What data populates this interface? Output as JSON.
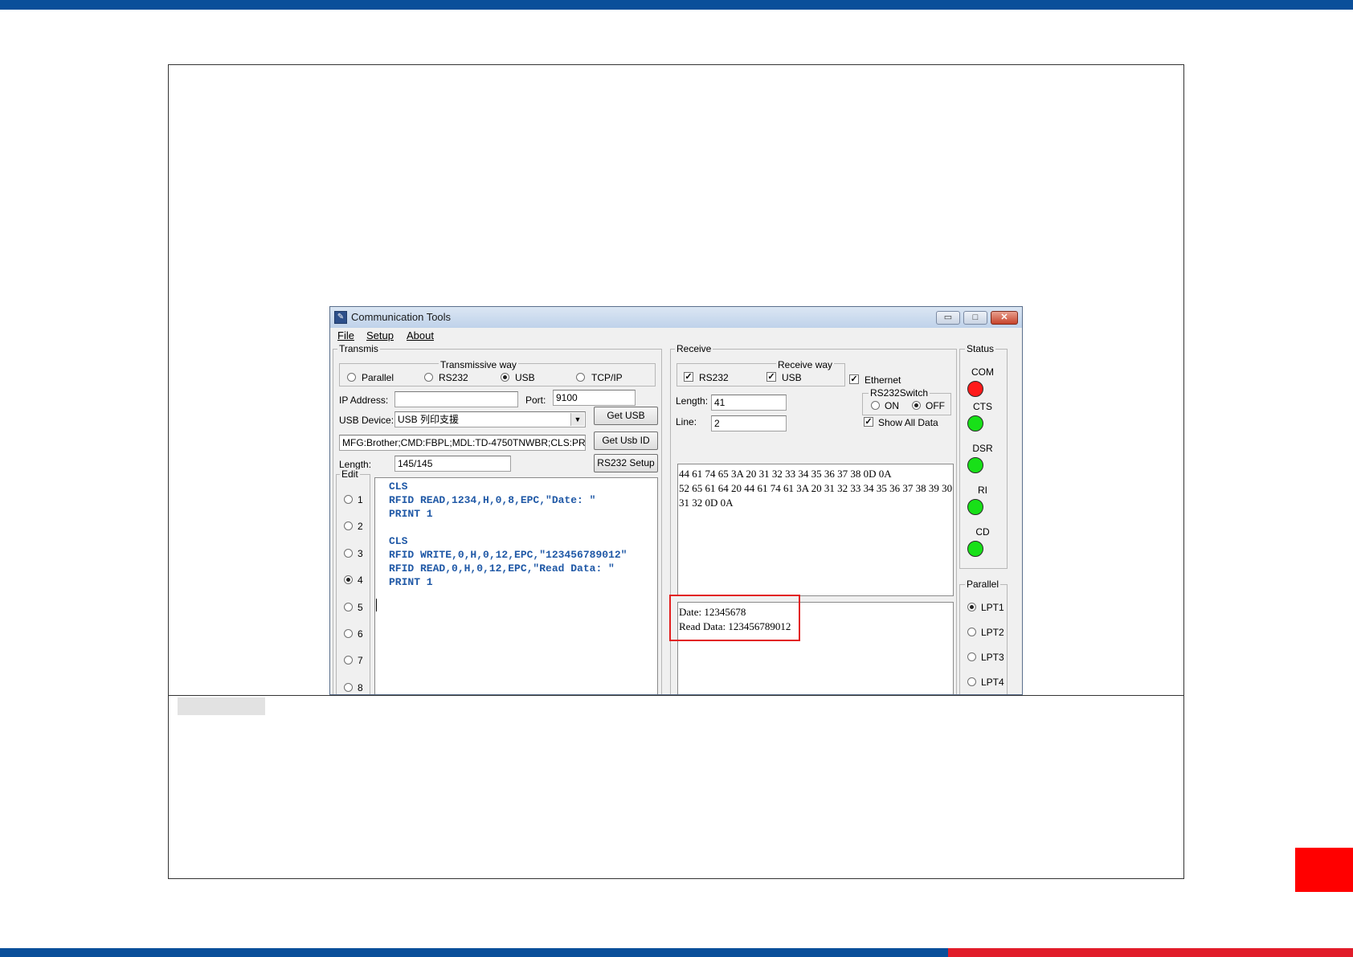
{
  "window": {
    "title": "Communication Tools",
    "icon": "app-icon",
    "controls": {
      "minimize": "▭",
      "maximize": "□",
      "close": "✕"
    }
  },
  "menu": [
    "File",
    "Setup",
    "About"
  ],
  "transmit": {
    "group_label": "Transmis",
    "way_label": "Transmissive way",
    "ways": [
      {
        "label": "Parallel",
        "selected": false
      },
      {
        "label": "RS232",
        "selected": false
      },
      {
        "label": "USB",
        "selected": true
      },
      {
        "label": "TCP/IP",
        "selected": false
      }
    ],
    "ip_label": "IP Address:",
    "ip_value": "",
    "port_label": "Port:",
    "port_value": "9100",
    "usb_device_label": "USB Device:",
    "usb_device_value": "USB 列印支援",
    "usb_id_value": "MFG:Brother;CMD:FBPL;MDL:TD-4750TNWBR;CLS:PRINTER",
    "length_label": "Length:",
    "length_value": "145/145",
    "get_usb_button": "Get USB",
    "get_usb_id_button": "Get Usb ID",
    "rs232_setup_button": "RS232 Setup"
  },
  "edit": {
    "group_label": "Edit",
    "slots": [
      {
        "label": "1",
        "selected": false
      },
      {
        "label": "2",
        "selected": false
      },
      {
        "label": "3",
        "selected": false
      },
      {
        "label": "4",
        "selected": true
      },
      {
        "label": "5",
        "selected": false
      },
      {
        "label": "6",
        "selected": false
      },
      {
        "label": "7",
        "selected": false
      },
      {
        "label": "8",
        "selected": false
      }
    ],
    "code": [
      "CLS",
      "RFID READ,1234,H,0,8,EPC,\"Date: \"",
      "PRINT 1",
      "",
      "CLS",
      "RFID WRITE,0,H,0,12,EPC,\"123456789012\"",
      "RFID READ,0,H,0,12,EPC,\"Read Data: \"",
      "PRINT 1"
    ]
  },
  "receive": {
    "group_label": "Receive",
    "way_label": "Receive way",
    "rs232_label": "RS232",
    "rs232_checked": true,
    "usb_label": "USB",
    "usb_checked": true,
    "ethernet_label": "Ethernet",
    "ethernet_checked": true,
    "switch_label": "RS232Switch",
    "switch_on": "ON",
    "switch_off": "OFF",
    "switch_state": "OFF",
    "length_label": "Length:",
    "length_value": "41",
    "line_label": "Line:",
    "line_value": "2",
    "show_all_label": "Show All Data",
    "show_all_checked": true,
    "hex_lines": [
      "44 61 74 65 3A 20 31 32 33 34 35 36 37 38 0D 0A",
      "52 65 61 64 20 44 61 74 61 3A 20 31 32 33 34 35 36 37 38 39 30",
      "31 32 0D 0A"
    ],
    "text_lines": [
      "Date: 12345678",
      "Read Data: 123456789012"
    ]
  },
  "status": {
    "group_label": "Status",
    "signals": [
      {
        "label": "COM",
        "color": "#ff1a1a"
      },
      {
        "label": "CTS",
        "color": "#18e018"
      },
      {
        "label": "DSR",
        "color": "#18e018"
      },
      {
        "label": "RI",
        "color": "#18e018"
      },
      {
        "label": "CD",
        "color": "#18e018"
      }
    ]
  },
  "parallel": {
    "group_label": "Parallel",
    "ports": [
      {
        "label": "LPT1",
        "selected": true
      },
      {
        "label": "LPT2",
        "selected": false
      },
      {
        "label": "LPT3",
        "selected": false
      },
      {
        "label": "LPT4",
        "selected": false
      }
    ]
  },
  "colors": {
    "top_band": "#0a4f9a",
    "bottom_band_blue": "#0a4f9a",
    "bottom_band_red": "#e11d2a",
    "side_tab": "#ff0000",
    "highlight_box": "#e21f1f",
    "code_text": "#1f58a6"
  }
}
